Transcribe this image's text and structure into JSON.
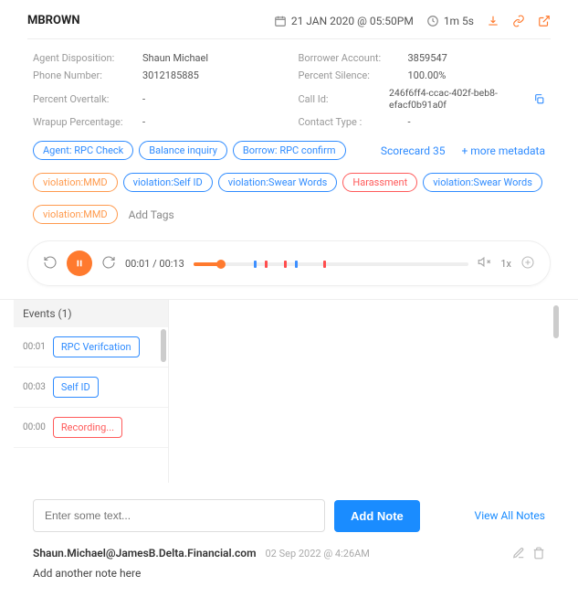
{
  "header": {
    "title": "MBROWN",
    "date": "21 JAN 2020 @ 05:50PM",
    "duration": "1m 5s"
  },
  "info": {
    "agent_disp_label": "Agent Disposition:",
    "agent_disp_val": "Shaun Michael",
    "phone_label": "Phone Number:",
    "phone_val": "3012185885",
    "overtalk_label": "Percent Overtalk:",
    "overtalk_val": "-",
    "wrapup_label": "Wrapup Percentage:",
    "wrapup_val": "-",
    "borrower_label": "Borrower Account:",
    "borrower_val": "3859547",
    "silence_label": "Percent Silence:",
    "silence_val": "100.00%",
    "callid_label": "Call Id:",
    "callid_val": "246f6ff4-ccac-402f-beb8-efacf0b91a0f",
    "contacttype_label": "Contact Type :",
    "contacttype_val": "-"
  },
  "tags": {
    "row1": [
      "Agent: RPC Check",
      "Balance inquiry",
      "Borrow: RPC confirm"
    ],
    "scorecard": "Scorecard 35",
    "metadata": "+ more metadata",
    "row2": [
      "violation:MMD",
      "violation:Self ID",
      "violation:Swear Words",
      "Harassment",
      "violation:Swear Words"
    ],
    "row3": [
      "violation:MMD"
    ],
    "add": "Add Tags"
  },
  "player": {
    "time": "00:01 / 00:13",
    "speed": "1x"
  },
  "events": {
    "title": "Events (1)",
    "list": [
      {
        "time": "00:01",
        "label": "RPC Verifcation",
        "cls": "evt-blue"
      },
      {
        "time": "00:03",
        "label": "Self ID",
        "cls": "evt-blue"
      },
      {
        "time": "00:00",
        "label": "Recording...",
        "cls": "evt-red"
      }
    ]
  },
  "notes": {
    "placeholder": "Enter some text...",
    "add_btn": "Add Note",
    "view_all": "View All Notes",
    "email": "Shaun.Michael@JamesB.Delta.Financial.com",
    "date": "02 Sep 2022 @ 4:26AM",
    "body": "Add another note here"
  }
}
